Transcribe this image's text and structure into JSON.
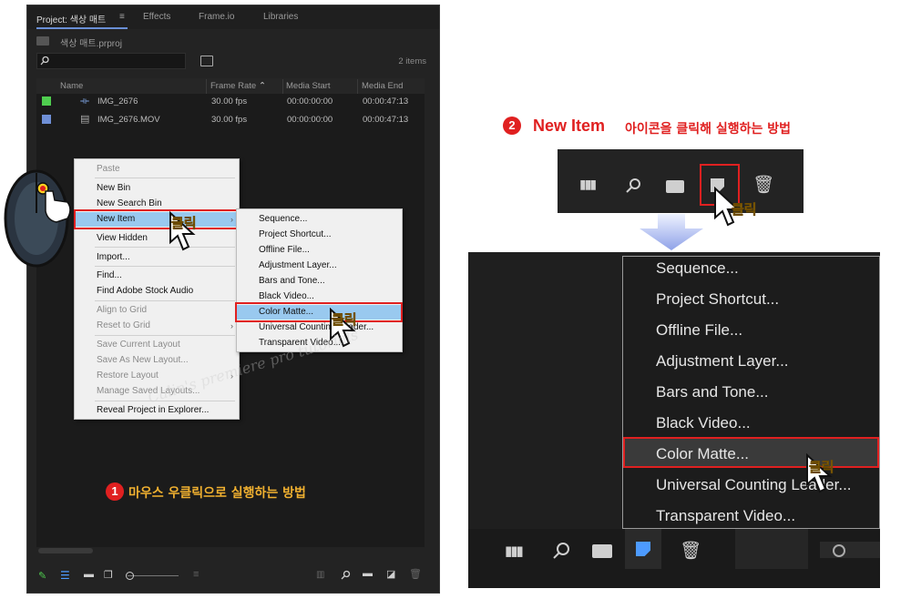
{
  "panel": {
    "tabs": [
      "Project: 색상 매트",
      "Effects",
      "Frame.io",
      "Libraries"
    ],
    "tab_menu_icon": "hamburger-icon",
    "project_file": "색상 매트.prproj",
    "item_count": "2 items",
    "columns": [
      "Name",
      "Frame Rate",
      "Media Start",
      "Media End"
    ],
    "rows": [
      {
        "color": "#4fcd4f",
        "name": "IMG_2676",
        "frame_rate": "30.00 fps",
        "media_start": "00:00:00:00",
        "media_end": "00:00:47:13"
      },
      {
        "color": "#6f8fd6",
        "name": "IMG_2676.MOV",
        "frame_rate": "30.00 fps",
        "media_start": "00:00:00:00",
        "media_end": "00:00:47:13"
      }
    ]
  },
  "context_menu": {
    "items": [
      {
        "label": "Paste",
        "disabled": true
      },
      {
        "label": "New Bin",
        "disabled": false
      },
      {
        "label": "New Search Bin",
        "disabled": false
      },
      {
        "label": "New Item",
        "disabled": false,
        "submenu": true,
        "highlighted": true
      },
      {
        "label": "View Hidden",
        "disabled": false
      },
      {
        "label": "Import...",
        "disabled": false
      },
      {
        "label": "Find...",
        "disabled": false
      },
      {
        "label": "Find Adobe Stock Audio",
        "disabled": false
      },
      {
        "label": "Align to Grid",
        "disabled": true
      },
      {
        "label": "Reset to Grid",
        "disabled": true,
        "submenu": true
      },
      {
        "label": "Save Current Layout",
        "disabled": true
      },
      {
        "label": "Save As New Layout...",
        "disabled": true
      },
      {
        "label": "Restore Layout",
        "disabled": true,
        "submenu": true
      },
      {
        "label": "Manage Saved Layouts...",
        "disabled": true
      },
      {
        "label": "Reveal Project in Explorer...",
        "disabled": false
      }
    ]
  },
  "submenu": {
    "items": [
      "Sequence...",
      "Project Shortcut...",
      "Offline File...",
      "Adjustment Layer...",
      "Bars and Tone...",
      "Black Video...",
      "Color Matte...",
      "Universal Counting Leader...",
      "Transparent Video..."
    ],
    "selected": "Color Matte..."
  },
  "big_menu": {
    "items": [
      "Sequence...",
      "Project Shortcut...",
      "Offline File...",
      "Adjustment Layer...",
      "Bars and Tone...",
      "Black Video...",
      "Color Matte...",
      "Universal Counting Leader...",
      "Transparent Video..."
    ],
    "selected": "Color Matte..."
  },
  "annotations": {
    "step1_number": "1",
    "step1_text": "마우스 우클릭으로 실행하는 방법",
    "step2_number": "2",
    "step2_title": "New Item",
    "step2_text": "아이콘을 클릭해 실행하는 방법",
    "click_label": "클릭",
    "watermark": "Calin's premiere pro tutorials"
  },
  "colors": {
    "accent_red": "#e02020",
    "highlight_blue": "#99c9ef",
    "panel_bg": "#232323"
  }
}
